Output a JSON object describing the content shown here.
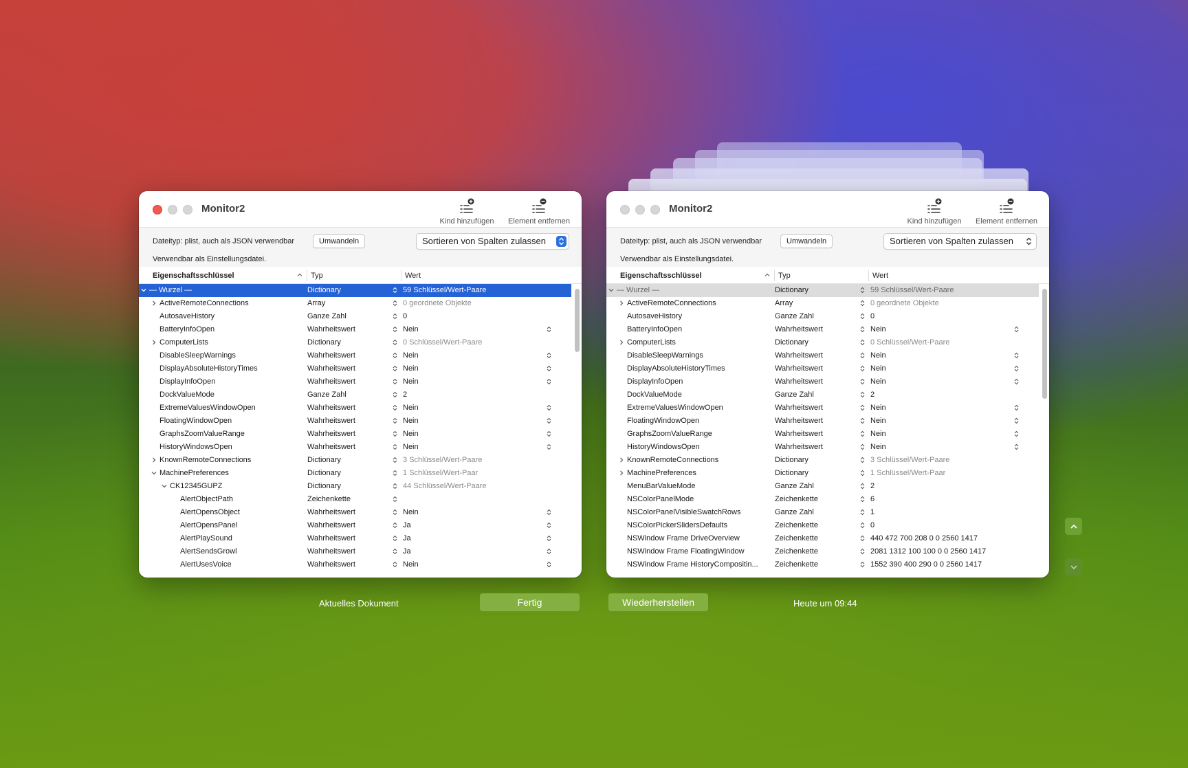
{
  "left_window": {
    "title": "Monitor2",
    "add_child_label": "Kind hinzufügen",
    "remove_label": "Element entfernen",
    "filetype": "Dateityp: plist, auch als JSON verwendbar",
    "convert_label": "Umwandeln",
    "sort_label": "Sortieren von Spalten zulassen",
    "usable": "Verwendbar als Einstellungsdatei.",
    "col_key": "Eigenschaftsschlüssel",
    "col_type": "Typ",
    "col_value": "Wert",
    "rows": [
      {
        "key": "— Wurzel —",
        "type": "Dictionary",
        "value": "59 Schlüssel/Wert-Paare"
      },
      {
        "key": "ActiveRemoteConnections",
        "type": "Array",
        "value": "0 geordnete Objekte"
      },
      {
        "key": "AutosaveHistory",
        "type": "Ganze Zahl",
        "value": "0"
      },
      {
        "key": "BatteryInfoOpen",
        "type": "Wahrheitswert",
        "value": "Nein"
      },
      {
        "key": "ComputerLists",
        "type": "Dictionary",
        "value": "0 Schlüssel/Wert-Paare"
      },
      {
        "key": "DisableSleepWarnings",
        "type": "Wahrheitswert",
        "value": "Nein"
      },
      {
        "key": "DisplayAbsoluteHistoryTimes",
        "type": "Wahrheitswert",
        "value": "Nein"
      },
      {
        "key": "DisplayInfoOpen",
        "type": "Wahrheitswert",
        "value": "Nein"
      },
      {
        "key": "DockValueMode",
        "type": "Ganze Zahl",
        "value": "2"
      },
      {
        "key": "ExtremeValuesWindowOpen",
        "type": "Wahrheitswert",
        "value": "Nein"
      },
      {
        "key": "FloatingWindowOpen",
        "type": "Wahrheitswert",
        "value": "Nein"
      },
      {
        "key": "GraphsZoomValueRange",
        "type": "Wahrheitswert",
        "value": "Nein"
      },
      {
        "key": "HistoryWindowsOpen",
        "type": "Wahrheitswert",
        "value": "Nein"
      },
      {
        "key": "KnownRemoteConnections",
        "type": "Dictionary",
        "value": "3 Schlüssel/Wert-Paare"
      },
      {
        "key": "MachinePreferences",
        "type": "Dictionary",
        "value": "1 Schlüssel/Wert-Paar"
      },
      {
        "key": "CK12345GUPZ",
        "type": "Dictionary",
        "value": "44 Schlüssel/Wert-Paare"
      },
      {
        "key": "AlertObjectPath",
        "type": "Zeichenkette",
        "value": ""
      },
      {
        "key": "AlertOpensObject",
        "type": "Wahrheitswert",
        "value": "Nein"
      },
      {
        "key": "AlertOpensPanel",
        "type": "Wahrheitswert",
        "value": "Ja"
      },
      {
        "key": "AlertPlaySound",
        "type": "Wahrheitswert",
        "value": "Ja"
      },
      {
        "key": "AlertSendsGrowl",
        "type": "Wahrheitswert",
        "value": "Ja"
      },
      {
        "key": "AlertUsesVoice",
        "type": "Wahrheitswert",
        "value": "Nein"
      }
    ]
  },
  "right_window": {
    "title": "Monitor2",
    "add_child_label": "Kind hinzufügen",
    "remove_label": "Element entfernen",
    "filetype": "Dateityp: plist, auch als JSON verwendbar",
    "convert_label": "Umwandeln",
    "sort_label": "Sortieren von Spalten zulassen",
    "usable": "Verwendbar als Einstellungsdatei.",
    "col_key": "Eigenschaftsschlüssel",
    "col_type": "Typ",
    "col_value": "Wert",
    "rows": [
      {
        "key": "— Wurzel —",
        "type": "Dictionary",
        "value": "59 Schlüssel/Wert-Paare"
      },
      {
        "key": "ActiveRemoteConnections",
        "type": "Array",
        "value": "0 geordnete Objekte"
      },
      {
        "key": "AutosaveHistory",
        "type": "Ganze Zahl",
        "value": "0"
      },
      {
        "key": "BatteryInfoOpen",
        "type": "Wahrheitswert",
        "value": "Nein"
      },
      {
        "key": "ComputerLists",
        "type": "Dictionary",
        "value": "0 Schlüssel/Wert-Paare"
      },
      {
        "key": "DisableSleepWarnings",
        "type": "Wahrheitswert",
        "value": "Nein"
      },
      {
        "key": "DisplayAbsoluteHistoryTimes",
        "type": "Wahrheitswert",
        "value": "Nein"
      },
      {
        "key": "DisplayInfoOpen",
        "type": "Wahrheitswert",
        "value": "Nein"
      },
      {
        "key": "DockValueMode",
        "type": "Ganze Zahl",
        "value": "2"
      },
      {
        "key": "ExtremeValuesWindowOpen",
        "type": "Wahrheitswert",
        "value": "Nein"
      },
      {
        "key": "FloatingWindowOpen",
        "type": "Wahrheitswert",
        "value": "Nein"
      },
      {
        "key": "GraphsZoomValueRange",
        "type": "Wahrheitswert",
        "value": "Nein"
      },
      {
        "key": "HistoryWindowsOpen",
        "type": "Wahrheitswert",
        "value": "Nein"
      },
      {
        "key": "KnownRemoteConnections",
        "type": "Dictionary",
        "value": "3 Schlüssel/Wert-Paare"
      },
      {
        "key": "MachinePreferences",
        "type": "Dictionary",
        "value": "1 Schlüssel/Wert-Paar"
      },
      {
        "key": "MenuBarValueMode",
        "type": "Ganze Zahl",
        "value": "2"
      },
      {
        "key": "NSColorPanelMode",
        "type": "Zeichenkette",
        "value": "6"
      },
      {
        "key": "NSColorPanelVisibleSwatchRows",
        "type": "Ganze Zahl",
        "value": "1"
      },
      {
        "key": "NSColorPickerSlidersDefaults",
        "type": "Zeichenkette",
        "value": "0"
      },
      {
        "key": "NSWindow Frame DriveOverview",
        "type": "Zeichenkette",
        "value": "440 472 700 208 0 0 2560 1417"
      },
      {
        "key": "NSWindow Frame FloatingWindow",
        "type": "Zeichenkette",
        "value": "2081 1312 100 100 0 0 2560 1417"
      },
      {
        "key": "NSWindow Frame HistoryCompositin...",
        "type": "Zeichenkette",
        "value": "1552 390 400 290 0 0 2560 1417"
      }
    ]
  },
  "footer": {
    "current_document": "Aktuelles Dokument",
    "done_label": "Fertig",
    "restore_label": "Wiederherstellen",
    "timestamp": "Heute um 09:44"
  },
  "colors": {
    "selection_active": "#2462d6",
    "selection_inactive": "#dcdcdc",
    "close_red": "#ee5a52",
    "light_gray": "#d6d6d6",
    "green_button": "#83b040"
  }
}
